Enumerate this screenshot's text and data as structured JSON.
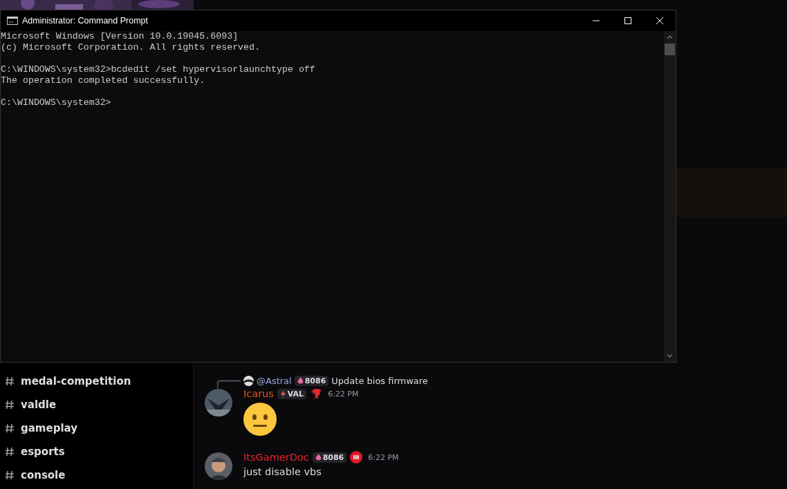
{
  "console_window": {
    "title": "Administrator: Command Prompt",
    "blocks": [
      {
        "lines": [
          "Microsoft Windows [Version 10.0.19045.6093]",
          "(c) Microsoft Corporation. All rights reserved."
        ]
      },
      {
        "lines": [
          "C:\\WINDOWS\\system32>bcdedit /set hypervisorlaunchtype off",
          "The operation completed successfully."
        ]
      },
      {
        "lines": [
          "C:\\WINDOWS\\system32>"
        ]
      }
    ]
  },
  "sidebar": {
    "channels": [
      {
        "name": "medal-competition"
      },
      {
        "name": "valdle"
      },
      {
        "name": "gameplay"
      },
      {
        "name": "esports"
      },
      {
        "name": "console"
      }
    ]
  },
  "chat": {
    "messages": [
      {
        "kind": "emoji",
        "reply": {
          "author": "@Astral",
          "badge": "8086",
          "text": "Update bios firmware"
        },
        "author": "Icarus",
        "color": "#e8531f",
        "tag": "VAL",
        "time": "6:22 PM"
      },
      {
        "kind": "text",
        "author": "ItsGamerDoc",
        "color": "#e2262c",
        "tag": "8086",
        "time": "6:22 PM",
        "text": "just disable vbs"
      }
    ]
  }
}
